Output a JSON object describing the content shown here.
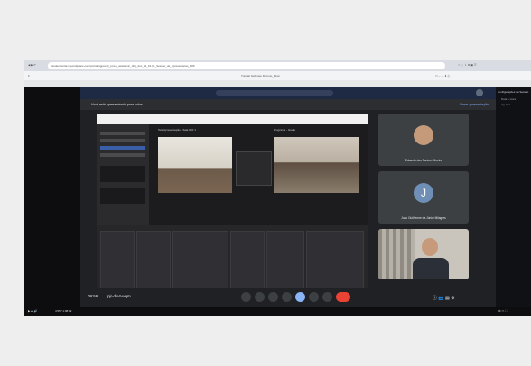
{
  "browser": {
    "url": "studentportal.myworkplace.com/portal/fsgpconti_prova_academic_drig_doc_02_01-01_Sessao_de_Apresentacao_PDF",
    "tab_title": "Tutorial Gabinete Remoto_Final"
  },
  "meet": {
    "presenting_label": "Você está apresentando para todos",
    "stop_label": "Parar apresentação",
    "meeting_time": "09:56",
    "meeting_code": "pjr-dkvt-wqm",
    "participants": [
      {
        "name": "Eduardo dos Santos Oliveira",
        "initial": ""
      },
      {
        "name": "João Guilherme da Júnior Milagres",
        "initial": "J"
      }
    ]
  },
  "obs": {
    "scene_title": "Tela Apresentação - Sala R R 1",
    "program_title": "Programa - Grade"
  },
  "side_panel": {
    "title": "Configurações da Sessão",
    "lines": [
      "Data e Hora",
      "Ag. Est."
    ]
  },
  "player": {
    "time": "4:55 / 1:08:09"
  },
  "colors": {
    "accent": "#1a73e8",
    "leave": "#ea4335"
  }
}
